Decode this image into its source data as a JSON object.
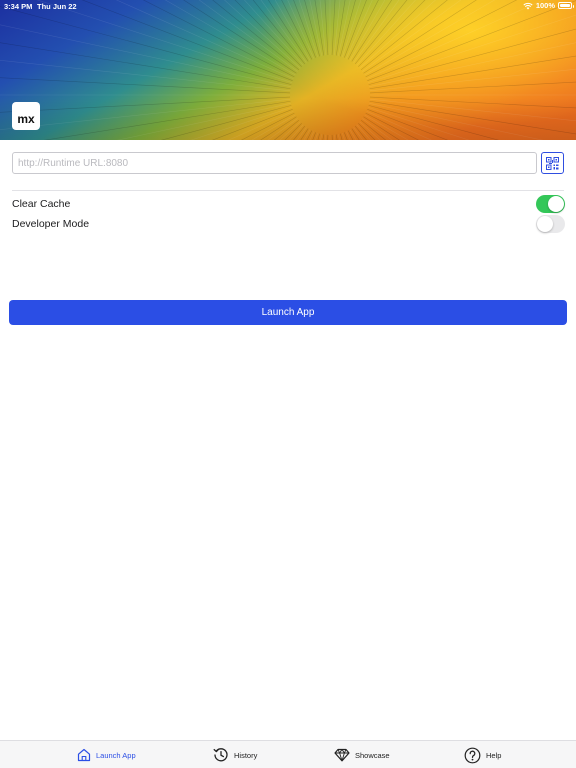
{
  "status_bar": {
    "time": "3:34 PM",
    "date": "Thu Jun 22",
    "battery": "100%",
    "battery_level": 1.0,
    "icons": [
      "wifi-icon",
      "battery-icon"
    ]
  },
  "header": {
    "logo_text": "mx"
  },
  "url_input": {
    "placeholder": "http://Runtime URL:8080",
    "value": ""
  },
  "qr_button": {
    "icon": "qr-code-icon"
  },
  "settings": {
    "clear_cache": {
      "label": "Clear Cache",
      "enabled": true
    },
    "developer_mode": {
      "label": "Developer Mode",
      "enabled": false
    }
  },
  "launch_button": {
    "label": "Launch App"
  },
  "tabbar": {
    "tabs": [
      {
        "label": "Launch App",
        "icon": "home-icon",
        "active": true
      },
      {
        "label": "History",
        "icon": "history-icon",
        "active": false
      },
      {
        "label": "Showcase",
        "icon": "diamond-icon",
        "active": false
      },
      {
        "label": "Help",
        "icon": "help-icon",
        "active": false
      }
    ]
  },
  "colors": {
    "accent": "#2b4ee5",
    "toggle_on": "#34c759",
    "toggle_off": "#e9e9eb"
  }
}
